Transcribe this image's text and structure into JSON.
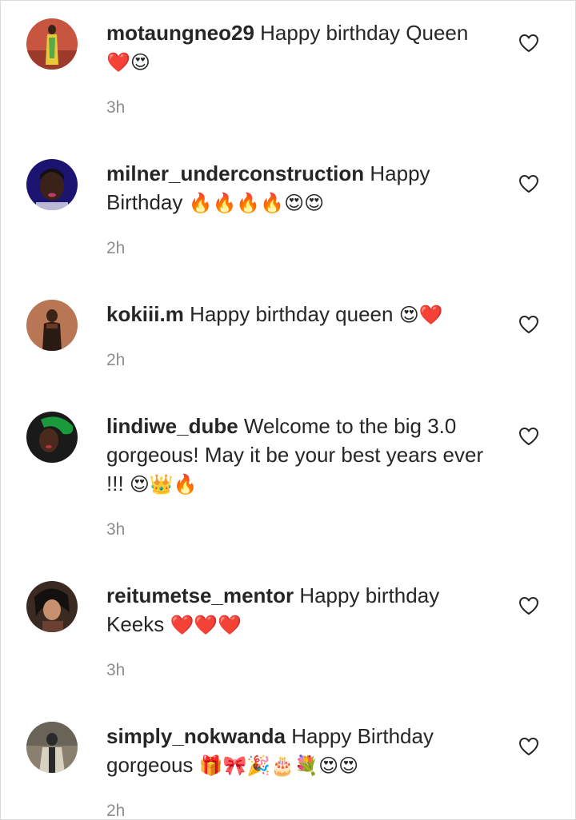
{
  "comments": [
    {
      "username": "motaungneo29",
      "text": "Happy birthday Queen",
      "emoji": "❤️😍",
      "time": "3h",
      "avatar": {
        "bg": "#c8553f",
        "accent": "#e8c93a"
      }
    },
    {
      "username": "milner_underconstruction",
      "text": "Happy Birthday",
      "emoji": "🔥🔥🔥🔥😍😍",
      "time": "2h",
      "avatar": {
        "bg": "#1c1470",
        "accent": "#c03a6a"
      }
    },
    {
      "username": "kokiii.m",
      "text": "Happy birthday queen",
      "emoji": "😍❤️",
      "time": "2h",
      "avatar": {
        "bg": "#b06a4a",
        "accent": "#2a1a14"
      }
    },
    {
      "username": "lindiwe_dube",
      "text": "Welcome to the big 3.0 gorgeous! May it be your best years ever !!!",
      "emoji": "😍👑🔥",
      "time": "3h",
      "avatar": {
        "bg": "#1a1a1a",
        "accent": "#1b9a3c"
      }
    },
    {
      "username": "reitumetse_mentor",
      "text": "Happy birthday Keeks",
      "emoji": "❤️❤️❤️",
      "time": "3h",
      "avatar": {
        "bg": "#3a2a22",
        "accent": "#c99070"
      }
    },
    {
      "username": "simply_nokwanda",
      "text": "Happy Birthday gorgeous",
      "emoji": "🎁🎀🎉🎂💐😍😍",
      "time": "2h",
      "avatar": {
        "bg": "#8a8070",
        "accent": "#2a2a2a"
      }
    }
  ],
  "icons": {
    "like": "heart-outline-icon"
  },
  "colors": {
    "username": "#262626",
    "text": "#262626",
    "timestamp": "#8e8e8e",
    "border": "#dbdbdb"
  }
}
